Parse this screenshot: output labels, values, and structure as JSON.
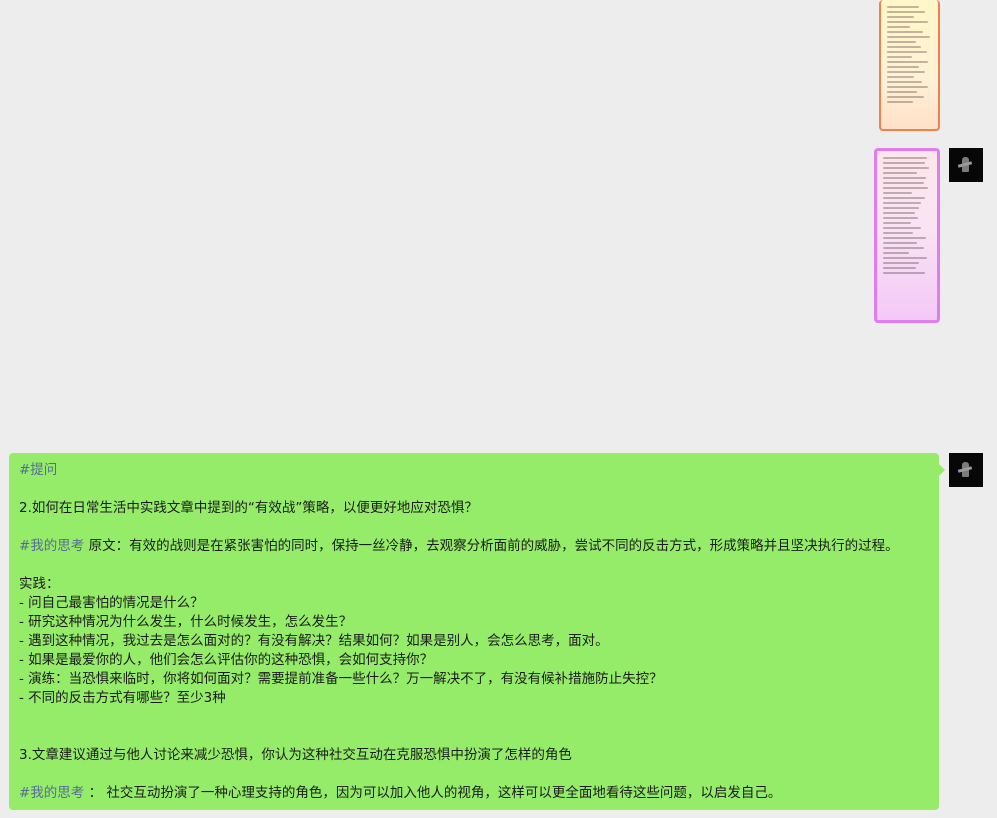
{
  "images": [
    {
      "name": "shared-image-orange",
      "description": "tall screenshot thumbnail with orange border"
    },
    {
      "name": "shared-image-pink",
      "description": "tall screenshot thumbnail with pink border"
    }
  ],
  "message": {
    "tag_question": "#提问",
    "q2": "2.如何在日常生活中实践文章中提到的“有效战”策略，以便更好地应对恐惧？",
    "tag_thinking": "#我的思考",
    "a2": " 原文：有效的战则是在紧张害怕的同时，保持一丝冷静，去观察分析面前的威胁，尝试不同的反击方式，形成策略并且坚决执行的过程。",
    "practice_title": "实践：",
    "practice": [
      "- 问自己最害怕的情况是什么？",
      "- 研究这种情况为什么发生，什么时候发生，怎么发生？",
      "- 遇到这种情况，我过去是怎么面对的？有没有解决？结果如何？如果是别人，会怎么思考，面对。",
      "- 如果是最爱你的人，他们会怎么评估你的这种恐惧，会如何支持你？",
      "- 演练：当恐惧来临时，你将如何面对？需要提前准备一些什么？万一解决不了，有没有候补措施防止失控？",
      "- 不同的反击方式有哪些？至少3种"
    ],
    "q3": "3.文章建议通过与他人讨论来减少恐惧，你认为这种社交互动在克服恐惧中扮演了怎样的角色",
    "tag_thinking2": "#我的思考",
    "a3": " ： 社交互动扮演了一种心理支持的角色，因为可以加入他人的视角，这样可以更全面地看待这些问题，以启发自己。"
  },
  "colors": {
    "background": "#ededed",
    "bubble": "#95ec69",
    "tag": "#576b95"
  },
  "icons": [
    "avatar"
  ]
}
